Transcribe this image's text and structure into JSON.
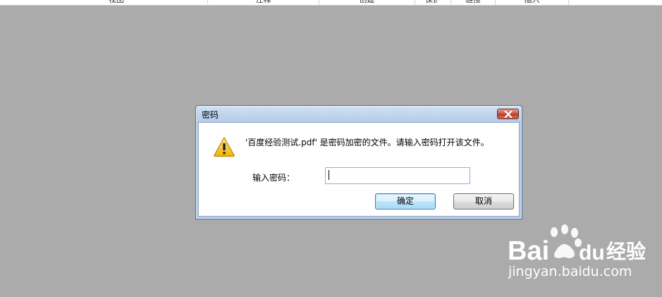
{
  "ribbon": {
    "groups": [
      "视图",
      "注释",
      "创建",
      "保护",
      "链接",
      "插入"
    ]
  },
  "dialog": {
    "title": "密码",
    "message": "'百度经验测试.pdf' 是密码加密的文件。请输入密码打开该文件。",
    "password_label": "输入密码：",
    "password_value": "",
    "ok_label": "确定",
    "cancel_label": "取消"
  },
  "watermark": {
    "logo_text_bai": "Bai",
    "logo_text_du": "du",
    "logo_text_cn": "经验",
    "url": "jingyan.baidu.com"
  },
  "colors": {
    "backdrop": "#ababab",
    "dialog_frame": "#b6cde9",
    "close_button": "#c7513c",
    "warning": "#f2c200"
  }
}
